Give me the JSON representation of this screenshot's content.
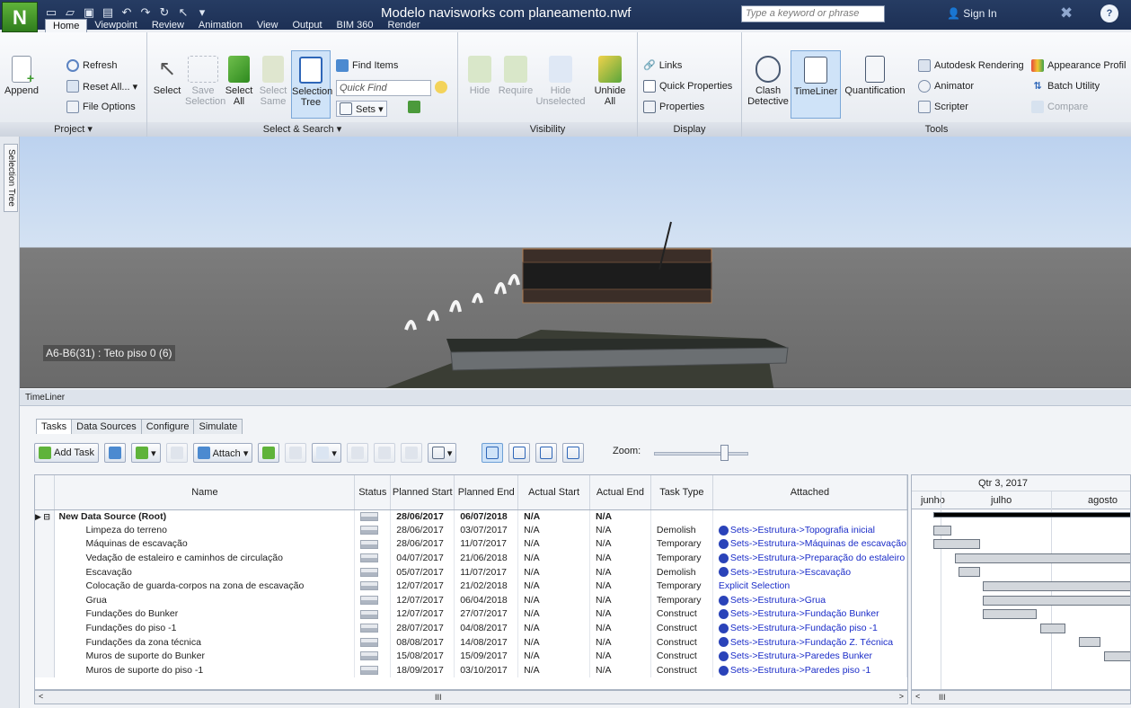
{
  "app": {
    "logo_letter": "N",
    "title": "Modelo navisworks com planeamento.nwf"
  },
  "search": {
    "placeholder": "Type a keyword or phrase"
  },
  "account": {
    "signin": "Sign In"
  },
  "ribbon_tabs": [
    "Home",
    "Viewpoint",
    "Review",
    "Animation",
    "View",
    "Output",
    "BIM 360",
    "Render"
  ],
  "ribbon": {
    "project": {
      "title": "Project ▾",
      "append": "Append",
      "refresh": "Refresh",
      "reset_all": "Reset All... ▾",
      "file_options": "File Options"
    },
    "select_search": {
      "title": "Select & Search ▾",
      "select": "Select",
      "save_selection": "Save Selection",
      "select_all": "Select All",
      "select_same": "Select Same",
      "selection_tree": "Selection Tree",
      "find_items": "Find Items",
      "quick_find": "Quick Find",
      "sets": "Sets ▾"
    },
    "visibility": {
      "title": "Visibility",
      "hide": "Hide",
      "require": "Require",
      "hide_unselected": "Hide Unselected",
      "unhide_all": "Unhide All"
    },
    "display": {
      "title": "Display",
      "links": "Links",
      "quick_properties": "Quick Properties",
      "properties": "Properties"
    },
    "tools": {
      "title": "Tools",
      "clash_detective": "Clash Detective",
      "timeliner": "TimeLiner",
      "quantification": "Quantification",
      "autodesk_rendering": "Autodesk Rendering",
      "animator": "Animator",
      "scripter": "Scripter",
      "appearance_profiler": "Appearance Profil",
      "batch_utility": "Batch Utility",
      "compare": "Compare"
    }
  },
  "side_tab": "Selection Tree",
  "viewport": {
    "label": "A6-B6(31) : Teto piso 0 (6)"
  },
  "timeliner": {
    "header": "TimeLiner",
    "tabs": [
      "Tasks",
      "Data Sources",
      "Configure",
      "Simulate"
    ],
    "toolbar": {
      "add_task": "Add Task",
      "attach": "Attach ▾",
      "zoom": "Zoom:"
    },
    "columns": [
      "Name",
      "Status",
      "Planned Start",
      "Planned End",
      "Actual Start",
      "Actual End",
      "Task Type",
      "Attached"
    ],
    "rows": [
      {
        "name": "New Data Source (Root)",
        "start": "28/06/2017",
        "end": "06/07/2018",
        "astart": "N/A",
        "aend": "N/A",
        "type": "",
        "attached": ""
      },
      {
        "name": "Limpeza do terreno",
        "start": "28/06/2017",
        "end": "03/07/2017",
        "astart": "N/A",
        "aend": "N/A",
        "type": "Demolish",
        "attached": "Sets->Estrutura->Topografia inicial"
      },
      {
        "name": "Máquinas de escavação",
        "start": "28/06/2017",
        "end": "11/07/2017",
        "astart": "N/A",
        "aend": "N/A",
        "type": "Temporary",
        "attached": "Sets->Estrutura->Máquinas de escavação"
      },
      {
        "name": "Vedação de estaleiro e caminhos de circulação",
        "start": "04/07/2017",
        "end": "21/06/2018",
        "astart": "N/A",
        "aend": "N/A",
        "type": "Temporary",
        "attached": "Sets->Estrutura->Preparação do estaleiro"
      },
      {
        "name": "Escavação",
        "start": "05/07/2017",
        "end": "11/07/2017",
        "astart": "N/A",
        "aend": "N/A",
        "type": "Demolish",
        "attached": "Sets->Estrutura->Escavação"
      },
      {
        "name": "Colocação de guarda-corpos na zona de escavação",
        "start": "12/07/2017",
        "end": "21/02/2018",
        "astart": "N/A",
        "aend": "N/A",
        "type": "Temporary",
        "attached": "Explicit Selection"
      },
      {
        "name": "Grua",
        "start": "12/07/2017",
        "end": "06/04/2018",
        "astart": "N/A",
        "aend": "N/A",
        "type": "Temporary",
        "attached": "Sets->Estrutura->Grua"
      },
      {
        "name": "Fundações do Bunker",
        "start": "12/07/2017",
        "end": "27/07/2017",
        "astart": "N/A",
        "aend": "N/A",
        "type": "Construct",
        "attached": "Sets->Estrutura->Fundação Bunker"
      },
      {
        "name": "Fundações do piso -1",
        "start": "28/07/2017",
        "end": "04/08/2017",
        "astart": "N/A",
        "aend": "N/A",
        "type": "Construct",
        "attached": "Sets->Estrutura->Fundação piso -1"
      },
      {
        "name": "Fundações da zona técnica",
        "start": "08/08/2017",
        "end": "14/08/2017",
        "astart": "N/A",
        "aend": "N/A",
        "type": "Construct",
        "attached": "Sets->Estrutura->Fundação Z. Técnica"
      },
      {
        "name": "Muros de suporte do Bunker",
        "start": "15/08/2017",
        "end": "15/09/2017",
        "astart": "N/A",
        "aend": "N/A",
        "type": "Construct",
        "attached": "Sets->Estrutura->Paredes Bunker"
      },
      {
        "name": "Muros de suporte do piso -1",
        "start": "18/09/2017",
        "end": "03/10/2017",
        "astart": "N/A",
        "aend": "N/A",
        "type": "Construct",
        "attached": "Sets->Estrutura->Paredes piso -1"
      }
    ],
    "gantt": {
      "quarter": "Qtr 3, 2017",
      "months": [
        "junho",
        "julho",
        "agosto"
      ]
    }
  },
  "colors": {
    "titlebar": "#263c63",
    "accent": "#2a43b9",
    "link": "#1a2cc8"
  }
}
